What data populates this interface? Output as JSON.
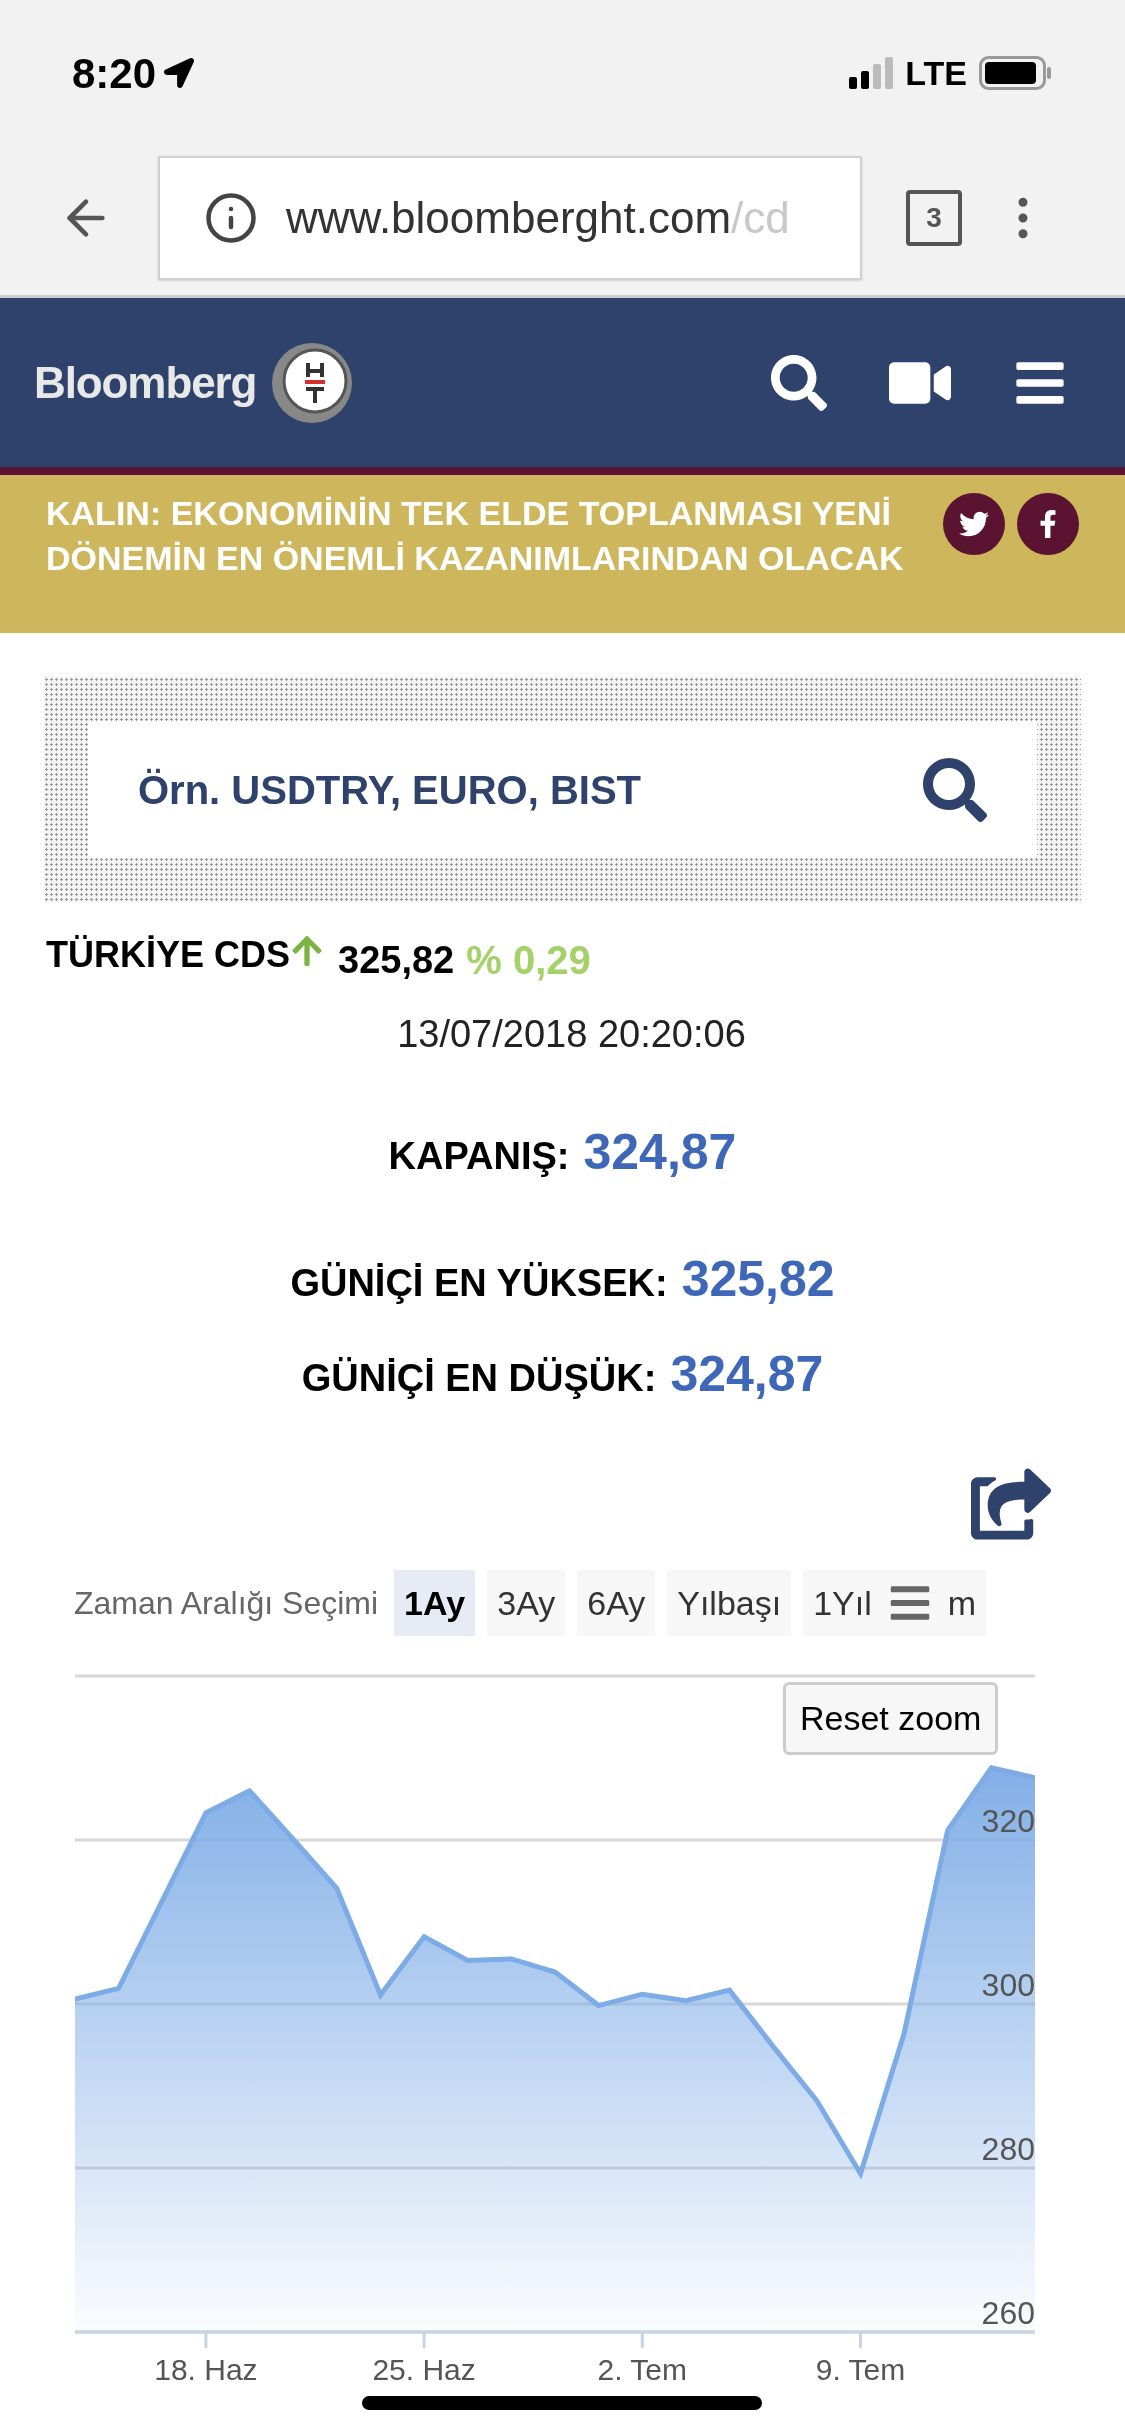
{
  "status_bar": {
    "time": "8:20",
    "network": "LTE"
  },
  "browser": {
    "url_main": "www.bloomberght.com",
    "url_faded": "/cd",
    "tab_count": "3"
  },
  "header": {
    "logo_text": "Bloomberg"
  },
  "banner": {
    "headline": "KALIN: EKONOMİNİN TEK ELDE TOPLANMASI YENİ DÖNEMİN EN ÖNEMLİ KAZANIMLARINDAN OLACAK"
  },
  "search": {
    "placeholder": "Örn. USDTRY, EURO, BIST"
  },
  "quote": {
    "name": "TÜRKİYE CDS",
    "price": "325,82",
    "change": "% 0,29",
    "timestamp": "13/07/2018 20:20:06"
  },
  "stats": [
    {
      "label": "KAPANIŞ:",
      "value": "324,87"
    },
    {
      "label": "GÜNİÇİ EN YÜKSEK:",
      "value": "325,82"
    },
    {
      "label": "GÜNİÇİ EN DÜŞÜK:",
      "value": "324,87"
    }
  ],
  "range": {
    "label": "Zaman Aralığı Seçimi",
    "buttons": [
      {
        "label": "1Ay",
        "selected": true
      },
      {
        "label": "3Ay",
        "selected": false
      },
      {
        "label": "6Ay",
        "selected": false
      },
      {
        "label": "Yılbaşı",
        "selected": false
      },
      {
        "label": "1Yıl",
        "selected": false
      },
      {
        "label": "m",
        "selected": false
      }
    ]
  },
  "reset_zoom": "Reset zoom",
  "chart_data": {
    "type": "area",
    "categories": [
      null,
      null,
      null,
      "18. Haz",
      null,
      null,
      null,
      null,
      "25. Haz",
      null,
      null,
      null,
      null,
      "2. Tem",
      null,
      null,
      null,
      null,
      "9. Tem",
      null,
      null,
      null,
      null
    ],
    "series": [
      {
        "color": "#7cabe6",
        "values": [
          300.6,
          301.9,
          312.6,
          323.3,
          326,
          320.1,
          314.1,
          301.1,
          308.2,
          305.3,
          305.5,
          303.9,
          299.8,
          301.2,
          300.4,
          301.7,
          294.8,
          288.2,
          279.3,
          296.4,
          321.2,
          328.8,
          327.6
        ]
      }
    ],
    "ylim": [
      260,
      340
    ],
    "grid": true,
    "yticks": [
      260,
      280,
      300,
      320
    ]
  }
}
